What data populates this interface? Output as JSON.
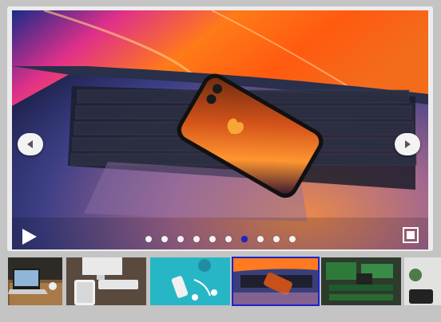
{
  "slider": {
    "slide_count": 10,
    "active_slide_index": 6,
    "main_image": "laptop-with-smartphone-on-keyboard"
  },
  "controls": {
    "prev_icon": "chevron-left-icon",
    "next_icon": "chevron-right-icon",
    "play_icon": "play-icon",
    "fullscreen_icon": "fullscreen-icon"
  },
  "thumbnails": [
    {
      "subject": "laptop-on-wooden-desk",
      "active": false
    },
    {
      "subject": "imac-keyboard-tablet",
      "active": false
    },
    {
      "subject": "phone-earbuds-teal",
      "active": false
    },
    {
      "subject": "laptop-with-smartphone",
      "active": true
    },
    {
      "subject": "circuit-boards-ram",
      "active": false
    },
    {
      "subject": "plant-and-phone",
      "active": false
    }
  ],
  "colors": {
    "active_accent": "#1d23c9",
    "dot_inactive": "#f4f4f4",
    "background": "#c4c4c4"
  }
}
